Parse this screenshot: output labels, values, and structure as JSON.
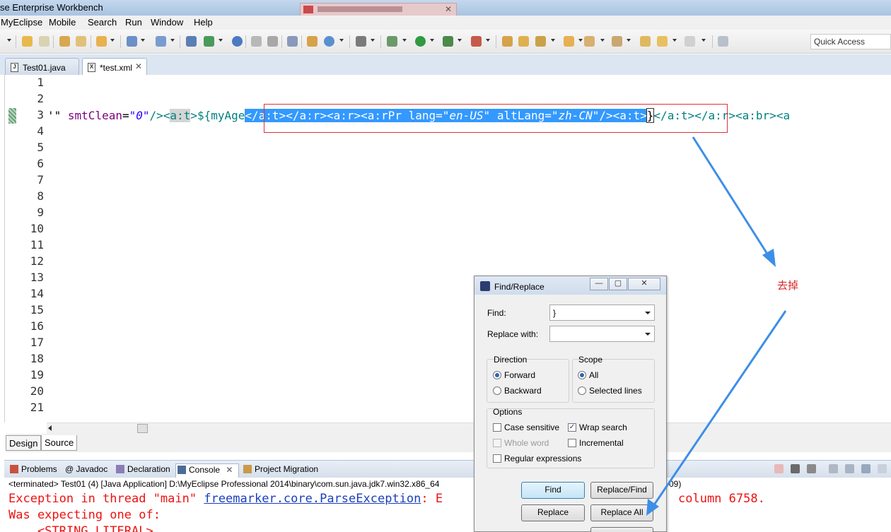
{
  "window": {
    "title": "se Enterprise Workbench"
  },
  "menu": [
    "MyEclipse",
    "Mobile",
    "Search",
    "Run",
    "Window",
    "Help"
  ],
  "quick_access": "Quick Access",
  "editor_tabs": [
    {
      "label": "Test01.java",
      "icon": "java-file-icon"
    },
    {
      "label": "*test.xml",
      "icon": "xml-file-icon"
    }
  ],
  "editor": {
    "line_numbers": [
      "1",
      "2",
      "3",
      "4",
      "5",
      "6",
      "7",
      "8",
      "9",
      "10",
      "11",
      "12",
      "13",
      "14",
      "15",
      "16",
      "17",
      "18",
      "19",
      "20",
      "21"
    ],
    "line3": {
      "p1": "'\" ",
      "attr1": "smtClean",
      "eq1": "=",
      "val1": "\"0\"",
      "p2": "/><",
      "occ": "a:t",
      "p3": ">${myAge",
      "sel1": "</a:t></a:r><a:r><a:rPr ",
      "sel_attr1": "lang",
      "sel_eq1": "=",
      "sel_val1": "\"en-US\"",
      "sel_sp": " ",
      "sel_attr2": "altLang",
      "sel_eq2": "=",
      "sel_val2": "\"zh-CN\"",
      "sel2": "/><a:t>",
      "p4": "}",
      "p5": "</a:t></a:r><a:br><a"
    }
  },
  "design_source_tabs": [
    "Design",
    "Source"
  ],
  "panel_tabs": [
    "Problems",
    "@ Javadoc",
    "Declaration",
    "Console",
    "Project Migration"
  ],
  "console": {
    "terminated": "<terminated> Test01 (4) [Java Application] D:\\MyEclipse Professional 2014\\binary\\com.sun.java.jdk7.win32.x86_64",
    "terminated_tail": "09)",
    "line1_prefix": "Exception in thread \"main\" ",
    "line1_link": "freemarker.core.ParseException",
    "line1_suffix": ": E",
    "line1_right": "column 6758.",
    "line2": "Was expecting one of:",
    "line3": "    <STRING_LITERAL>"
  },
  "dialog": {
    "title": "Find/Replace",
    "find_label": "Find:",
    "find_value": "}",
    "replace_label": "Replace with:",
    "replace_value": "",
    "direction_label": "Direction",
    "direction_options": [
      "Forward",
      "Backward"
    ],
    "direction_selected": "Forward",
    "scope_label": "Scope",
    "scope_options": [
      "All",
      "Selected lines"
    ],
    "scope_selected": "All",
    "options_label": "Options",
    "options": [
      {
        "label": "Case sensitive",
        "checked": false,
        "enabled": true
      },
      {
        "label": "Wrap search",
        "checked": true,
        "enabled": true
      },
      {
        "label": "Whole word",
        "checked": false,
        "enabled": false
      },
      {
        "label": "Incremental",
        "checked": false,
        "enabled": true
      },
      {
        "label": "Regular expressions",
        "checked": false,
        "enabled": true
      }
    ],
    "buttons": [
      "Find",
      "Replace/Find",
      "Replace",
      "Replace All"
    ]
  },
  "annotation": "去掉",
  "colors": {
    "annotation_red": "#d92828",
    "arrow_blue": "#3d8fe6",
    "selection_blue": "#3399ff",
    "error_red": "#ee1111"
  }
}
